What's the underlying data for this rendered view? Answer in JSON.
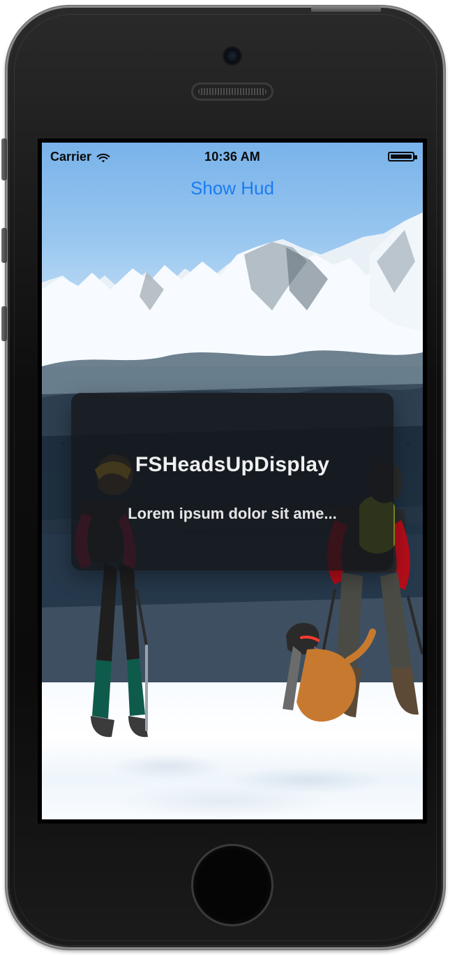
{
  "status_bar": {
    "carrier": "Carrier",
    "time": "10:36 AM",
    "wifi_icon": "wifi-icon",
    "battery_icon": "battery-icon",
    "battery_level_percent": 100
  },
  "main": {
    "show_hud_button_label": "Show Hud"
  },
  "hud": {
    "title": "FSHeadsUpDisplay",
    "message": "Lorem ipsum dolor sit ame..."
  },
  "colors": {
    "button_blue": "#1a7cf2",
    "hud_background": "#14161A",
    "hud_text": "#f0f0f0",
    "status_text": "#0a0a0a"
  }
}
